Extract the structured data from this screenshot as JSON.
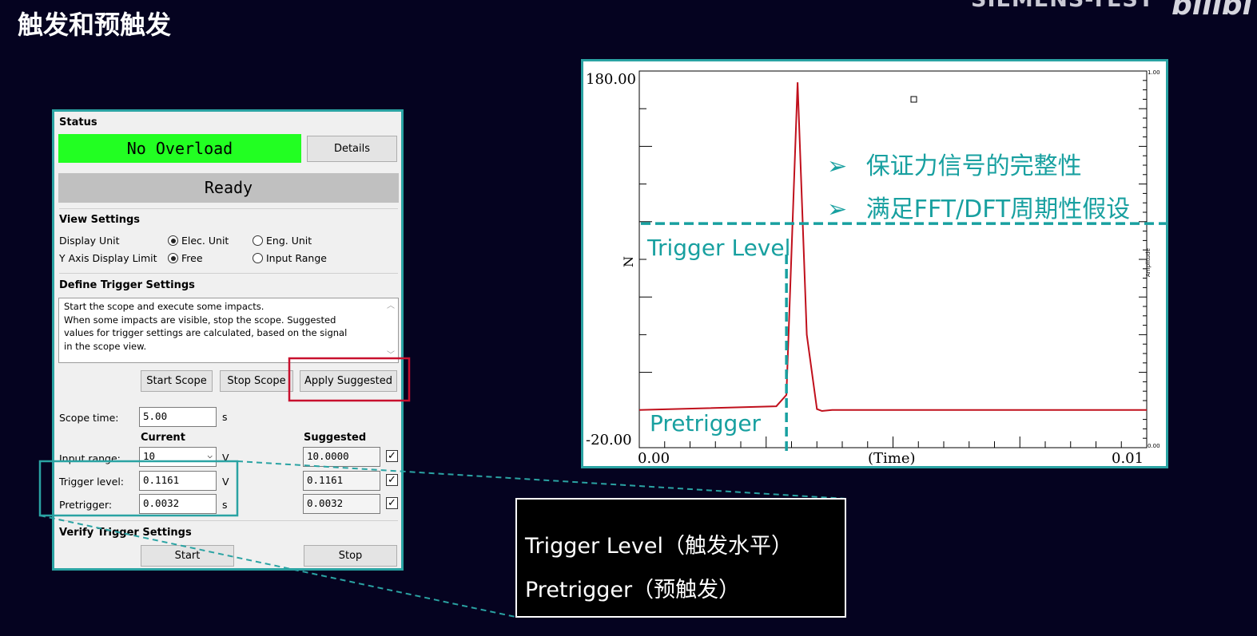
{
  "slide": {
    "title": "触发和预触发",
    "brand": "SIEMENS-TEST",
    "brand2": "bilibi"
  },
  "dialog": {
    "status": {
      "title": "Status",
      "overload_text": "No Overload",
      "details_label": "Details",
      "ready_text": "Ready",
      "overload_color": "#22ff22"
    },
    "view_settings": {
      "title": "View Settings",
      "display_unit_label": "Display Unit",
      "display_unit_opt1": "Elec. Unit",
      "display_unit_opt2": "Eng. Unit",
      "y_axis_label": "Y Axis Display Limit",
      "y_axis_opt1": "Free",
      "y_axis_opt2": "Input Range"
    },
    "trigger": {
      "title": "Define Trigger Settings",
      "info_line1": "Start the scope and execute some impacts.",
      "info_line2": "When some impacts are visible, stop the scope. Suggested",
      "info_line3": "values for trigger settings are calculated, based on the signal",
      "info_line4": "in the scope view.",
      "start_scope": "Start Scope",
      "stop_scope": "Stop Scope",
      "apply_suggested": "Apply Suggested",
      "scope_time_label": "Scope time:",
      "scope_time_value": "5.00",
      "scope_time_unit": "s",
      "current_header": "Current",
      "suggested_header": "Suggested",
      "input_range_label": "Input range:",
      "input_range_value": "10",
      "input_range_unit": "V",
      "input_range_suggested": "10.0000",
      "trigger_level_label": "Trigger level:",
      "trigger_level_value": "0.1161",
      "trigger_level_unit": "V",
      "trigger_level_suggested": "0.1161",
      "pretrigger_label": "Pretrigger:",
      "pretrigger_value": "0.0032",
      "pretrigger_unit": "s",
      "pretrigger_suggested": "0.0032"
    },
    "verify": {
      "title": "Verify Trigger Settings",
      "start": "Start",
      "stop": "Stop"
    }
  },
  "annotations": {
    "bullet1": "保证力信号的完整性",
    "bullet2": "满足FFT/DFT周期性假设",
    "trigger_level": "Trigger Level",
    "pretrigger": "Pretrigger",
    "bullet_glyph": "➢"
  },
  "legend": {
    "line1": "Trigger Level（触发水平）",
    "line2": "Pretrigger（预触发）"
  },
  "chart_data": {
    "type": "line",
    "ylabel": "N",
    "xlabel": "(Time)",
    "y_top_label": "180.00",
    "y_bottom_label": "-20.00",
    "x_left_label": "0.00",
    "x_right_label": "0.01",
    "right_top_label": "1.00",
    "right_bottom_label": "0.00",
    "right_axis_label": "Amplitude",
    "ylim": [
      -20,
      180
    ],
    "xlim": [
      0,
      0.01
    ],
    "x": [
      0,
      0.0027,
      0.0029,
      0.00312,
      0.0033,
      0.0035,
      0.0036,
      0.0038,
      0.01
    ],
    "y": [
      0,
      2,
      8,
      174,
      40,
      0.5,
      -0.5,
      0,
      0
    ],
    "trigger_level": 99,
    "pretrigger": 0.0029,
    "line_color": "#c0101c",
    "annotation_color": "#18a0a0"
  }
}
